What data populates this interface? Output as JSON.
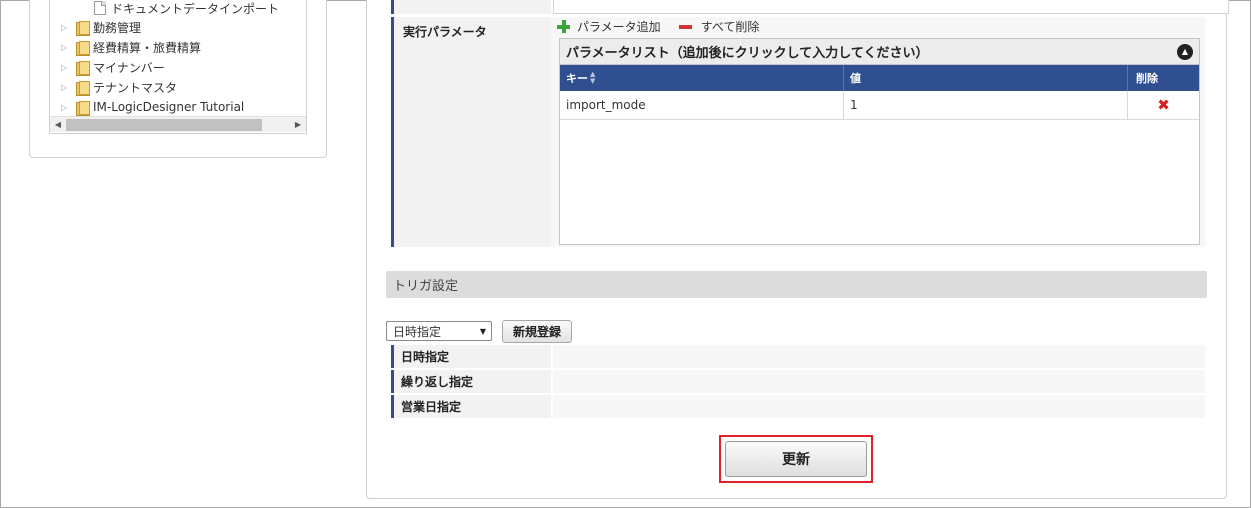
{
  "tree": {
    "items": [
      {
        "label": "ドキュメントデータインポート",
        "type": "doc"
      },
      {
        "label": "勤務管理",
        "type": "folder"
      },
      {
        "label": "経費精算・旅費精算",
        "type": "folder"
      },
      {
        "label": "マイナンバー",
        "type": "folder"
      },
      {
        "label": "テナントマスタ",
        "type": "folder"
      },
      {
        "label": "IM-LogicDesigner Tutorial",
        "type": "folder"
      }
    ]
  },
  "params": {
    "label": "実行パラメータ",
    "add_label": "パラメータ追加",
    "delete_all_label": "すべて削除",
    "list_title": "パラメータリスト（追加後にクリックして入力してください）",
    "columns": {
      "key": "キー",
      "value": "値",
      "delete": "削除"
    },
    "rows": [
      {
        "key": "import_mode",
        "value": "1"
      }
    ]
  },
  "trigger": {
    "section_title": "トリガ設定",
    "select_value": "日時指定",
    "new_button": "新規登録",
    "rows": [
      {
        "label": "日時指定"
      },
      {
        "label": "繰り返し指定"
      },
      {
        "label": "営業日指定"
      }
    ]
  },
  "actions": {
    "update_label": "更新"
  },
  "colors": {
    "accent_border": "#2d4f8c",
    "grid_header": "#2f4f91",
    "highlight": "#e0202a",
    "delete": "#d42020",
    "add": "#3aa53a"
  }
}
